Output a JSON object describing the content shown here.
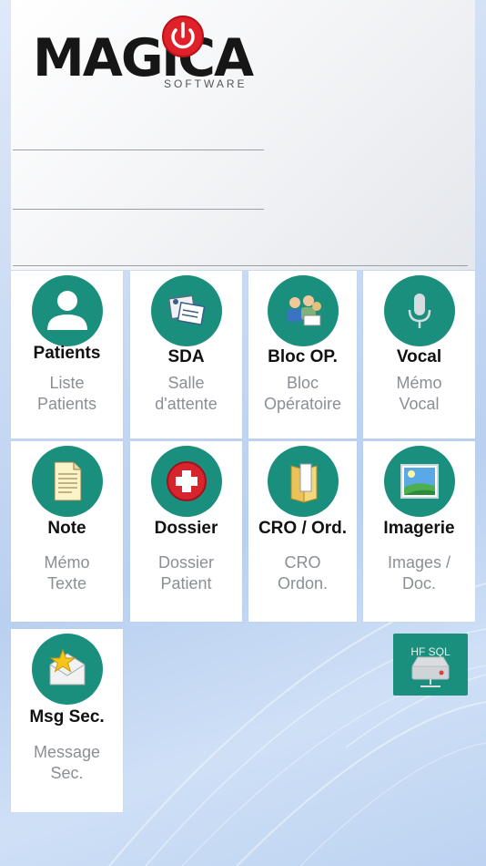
{
  "logo": {
    "word": "MAGiCA",
    "sub": "SOFTWARE"
  },
  "tiles": [
    {
      "title": "Patients",
      "sub1": "Liste",
      "sub2": "Patients",
      "icon": "person-icon"
    },
    {
      "title": "SDA",
      "sub1": "Salle",
      "sub2": "d'attente",
      "icon": "waiting-room-icon"
    },
    {
      "title": "Bloc OP.",
      "sub1": "Bloc",
      "sub2": "Opératoire",
      "icon": "surgery-team-icon"
    },
    {
      "title": "Vocal",
      "sub1": "Mémo",
      "sub2": "Vocal",
      "icon": "microphone-icon"
    },
    {
      "title": "Note",
      "sub1": "Mémo",
      "sub2": "Texte",
      "icon": "note-icon"
    },
    {
      "title": "Dossier",
      "sub1": "Dossier",
      "sub2": "Patient",
      "icon": "medical-cross-icon"
    },
    {
      "title": "CRO / Ord.",
      "sub1": "CRO",
      "sub2": "Ordon.",
      "icon": "folder-icon"
    },
    {
      "title": "Imagerie",
      "sub1": "Images /",
      "sub2": "Doc.",
      "icon": "landscape-image-icon"
    },
    {
      "title": "Msg Sec.",
      "sub1": "Message",
      "sub2": "Sec.",
      "icon": "star-envelope-icon"
    }
  ],
  "hfsql": {
    "label": "HF SQL",
    "icon": "database-drive-icon"
  },
  "colors": {
    "accent": "#1a8f7d",
    "tile_bg": "#ffffff",
    "title": "#111111",
    "subtitle": "#8a8f96"
  }
}
